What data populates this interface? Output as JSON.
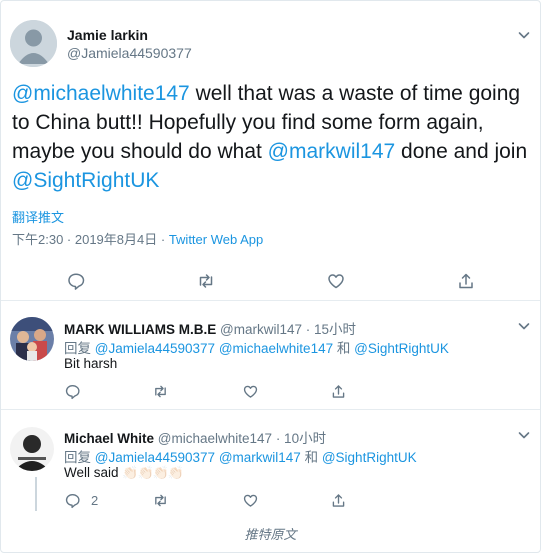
{
  "main_tweet": {
    "author_name": "Jamie larkin",
    "author_handle": "@Jamiela44590377",
    "text": {
      "mention1": "@michaelwhite147",
      "part1": " well that was a waste of time going to China butt!! Hopefully you find some form again, maybe you should do what ",
      "mention2": "@markwil147",
      "part2": " done and join ",
      "mention3": "@SightRightUK"
    },
    "translate_label": "翻译推文",
    "timestamp": "下午2:30 · 2019年8月4日",
    "separator": " · ",
    "source": "Twitter Web App"
  },
  "replies": [
    {
      "author_name": "MARK WILLIAMS M.B.E",
      "author_handle": "@markwil147",
      "time": "· 15小时",
      "reply_prefix": "回复",
      "reply_to_1": "@Jamiela44590377",
      "reply_to_2": "@michaelwhite147",
      "reply_and": "和",
      "reply_to_3": "@SightRightUK",
      "text": "Bit harsh"
    },
    {
      "author_name": "Michael White",
      "author_handle": "@michaelwhite147",
      "time": "· 10小时",
      "reply_prefix": "回复",
      "reply_to_1": "@Jamiela44590377",
      "reply_to_2": "@markwil147",
      "reply_and": "和",
      "reply_to_3": "@SightRightUK",
      "text": "Well said",
      "emoji": "👏🏻👏🏻👏🏻👏🏻",
      "reply_count": "2"
    }
  ],
  "footer_label": "推特原文",
  "colors": {
    "link": "#1b95e0",
    "muted": "#657786",
    "border": "#e6ecf0"
  }
}
